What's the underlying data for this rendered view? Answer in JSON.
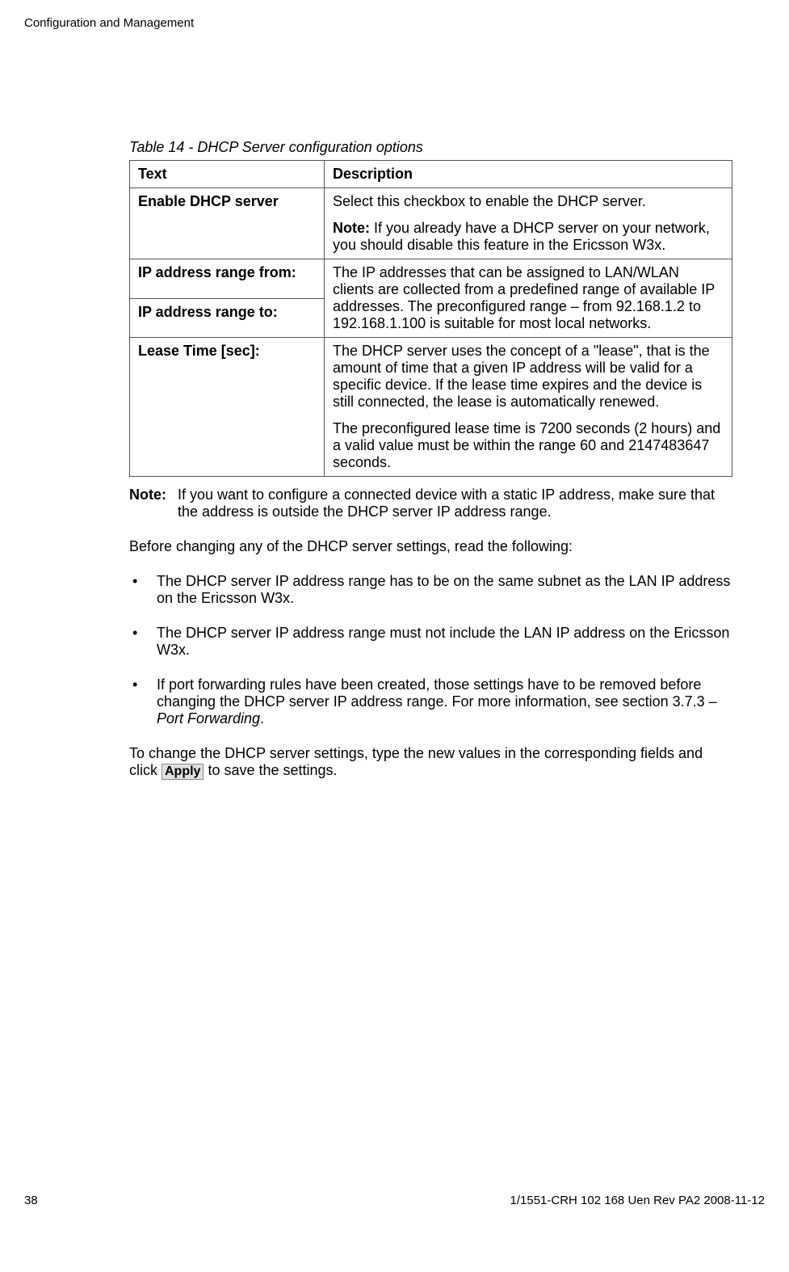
{
  "header": {
    "section_title": "Configuration and Management"
  },
  "table": {
    "caption": "Table 14 - DHCP Server configuration options",
    "head": {
      "col1": "Text",
      "col2": "Description"
    },
    "rows": {
      "r1": {
        "label": "Enable DHCP server",
        "desc_p1": "Select this checkbox to enable the DHCP server.",
        "desc_p2_prefix": "Note:",
        "desc_p2_rest": " If you already have a DHCP server on your network, you should disable this feature in the Ericsson W3x."
      },
      "r2a": {
        "label": "IP address range from:"
      },
      "r2b": {
        "label": "IP address range to:"
      },
      "r2_desc": "The IP addresses that can be assigned to LAN/WLAN clients are collected from a predefined range of available IP addresses. The preconfigured range – from 92.168.1.2 to 192.168.1.100 is suitable for most local networks.",
      "r3": {
        "label": "Lease Time [sec]:",
        "desc_p1": "The DHCP server uses the concept of a \"lease\", that is the amount of time that a given IP address will be valid for a specific device. If the lease time expires and the device is still connected, the lease is automatically renewed.",
        "desc_p2": "The preconfigured lease time is 7200 seconds (2 hours) and a valid value must be within the range 60 and 2147483647 seconds."
      }
    }
  },
  "note": {
    "label": "Note:",
    "text": "If you want to configure a connected device with a static IP address, make sure that the address is outside the DHCP server IP address range."
  },
  "paras": {
    "before_list": "Before changing any of the DHCP server settings, read the following:",
    "to_change_prefix": "To change the DHCP server settings, type the new values in the corresponding fields and click ",
    "to_change_suffix": " to save the settings."
  },
  "apply_btn": "Apply",
  "bullets": {
    "b1": "The DHCP server IP address range has to be on the same subnet as the LAN IP address on the Ericsson W3x.",
    "b2": "The DHCP server IP address range must not include the LAN IP address on the Ericsson W3x.",
    "b3_p1": "If port forwarding rules have been created, those settings have to be removed before changing the DHCP server IP address range. For more information, see section 3.7.3 – ",
    "b3_ital": "Port Forwarding",
    "b3_p2": "."
  },
  "footer": {
    "page": "38",
    "docid": "1/1551-CRH 102 168 Uen Rev PA2  2008-11-12"
  }
}
